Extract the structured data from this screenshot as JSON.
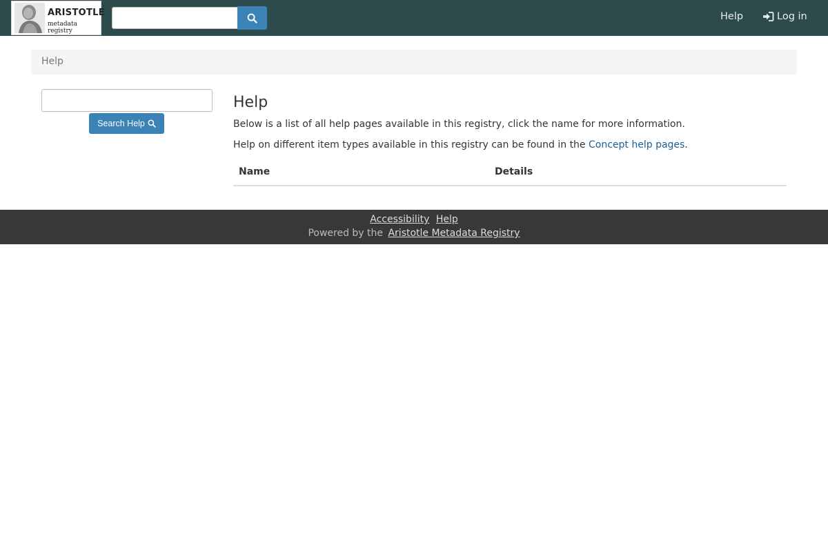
{
  "header": {
    "logo": {
      "title": "ARISTOTLE",
      "subtitle": "metadata registry"
    },
    "search": {
      "placeholder": "",
      "value": "",
      "button_icon": "search-icon"
    },
    "nav": {
      "help_label": "Help",
      "login_label": "Log in",
      "login_icon": "sign-in-icon"
    },
    "colors": {
      "navbar": "#2e4b4b",
      "primary_button": "#3b82b6"
    }
  },
  "breadcrumb": {
    "items": [
      "Help"
    ]
  },
  "sidebar": {
    "search": {
      "placeholder": "",
      "value": ""
    },
    "search_button_label": "Search Help",
    "search_button_icon": "search-icon"
  },
  "main": {
    "title": "Help",
    "intro": "Below is a list of all help pages available in this registry, click the name for more information.",
    "concept_prefix": "Help on different item types available in this registry can be found in the",
    "concept_link": "Concept help pages",
    "concept_suffix": ".",
    "table": {
      "columns": [
        "Name",
        "Details"
      ],
      "rows": []
    }
  },
  "footer": {
    "links": [
      "Accessibility",
      "Help"
    ],
    "powered_prefix": "Powered by the",
    "powered_link": "Aristotle Metadata Registry",
    "background": "#383838"
  }
}
